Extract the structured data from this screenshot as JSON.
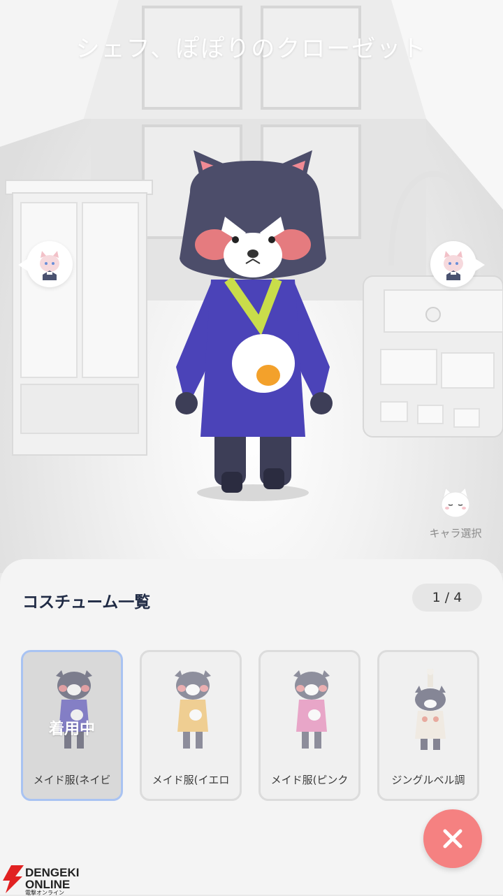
{
  "header": {
    "title": "シェフ、ぽぽりのクローゼット"
  },
  "scene": {
    "prev_character_icon": "character-face-icon",
    "next_character_icon": "character-face-icon",
    "character_select": {
      "label": "キャラ選択",
      "icon": "cat-face-icon"
    }
  },
  "costume_panel": {
    "title": "コスチューム一覧",
    "page_indicator": "1 / 4",
    "items": [
      {
        "label": "メイド服(ネイビ",
        "status": "着用中",
        "color": "#4b43b8",
        "selected": true
      },
      {
        "label": "メイド服(イエロ",
        "status": "",
        "color": "#efb347",
        "selected": false
      },
      {
        "label": "メイド服(ピンク",
        "status": "",
        "color": "#e26aa8",
        "selected": false
      },
      {
        "label": "ジングルベル調",
        "status": "",
        "color": "#f1e7da",
        "selected": false
      }
    ]
  },
  "close_button": {
    "icon": "close-icon"
  },
  "watermark": {
    "line1": "DENGEKI",
    "line2": "ONLINE",
    "line3": "電撃オンライン"
  },
  "colors": {
    "accent": "#f58181",
    "selected_border": "#a9c3f2",
    "title_text": "#1f2a44"
  }
}
